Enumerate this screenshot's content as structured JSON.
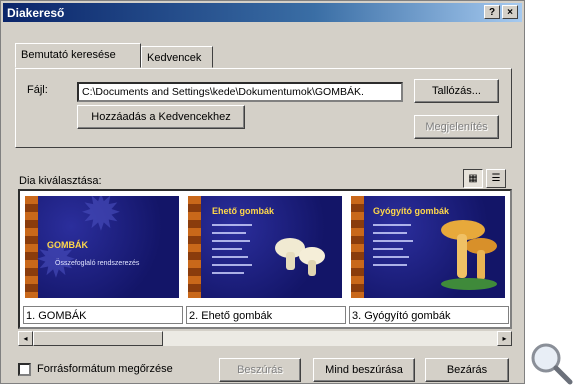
{
  "window": {
    "title": "Diakereső",
    "help_glyph": "?",
    "close_glyph": "×"
  },
  "tabs": [
    {
      "label": "Bemutató keresése"
    },
    {
      "label": "Kedvencek"
    }
  ],
  "file": {
    "label": "Fájl:",
    "value": "C:\\Documents and Settings\\kede\\Dokumentumok\\GOMBÁK."
  },
  "buttons": {
    "browse": "Tallózás...",
    "add_favorites": "Hozzáadás a Kedvencekhez",
    "display": "Megjelenítés",
    "insert": "Beszúrás",
    "insert_all": "Mind beszúrása",
    "close": "Bezárás"
  },
  "slide_select_label": "Dia kiválasztása:",
  "slides": [
    {
      "caption": "1. GOMBÁK",
      "title": "GOMBÁK",
      "subtitle": "Összefoglaló rendszerezés"
    },
    {
      "caption": "2. Ehető gombák",
      "title": "Ehető gombák"
    },
    {
      "caption": "3. Gyógyító gombák",
      "title": "Gyógyító gombák"
    }
  ],
  "keep_format": {
    "label": "Forrásformátum megőrzése",
    "checked": false
  },
  "icons": {
    "view_large": "large-thumbnails-icon",
    "view_list": "list-view-icon",
    "scroll_left": "◂",
    "scroll_right": "▸",
    "zoom": "magnifier-icon"
  },
  "colors": {
    "titlebar": "#0a246a",
    "dialog_bg": "#d4d0c8",
    "slide_bg": "#1c1f86",
    "slide_title": "#ffd84a"
  }
}
